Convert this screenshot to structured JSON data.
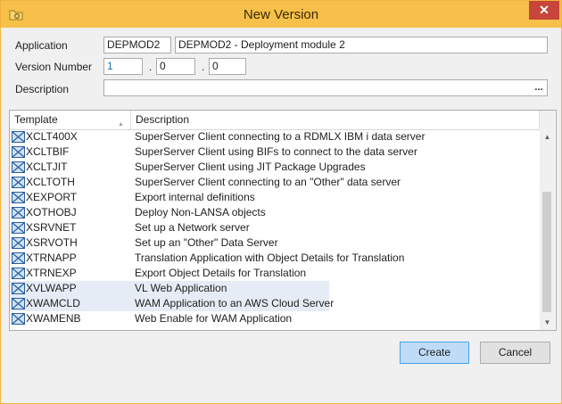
{
  "window": {
    "title": "New Version",
    "close_glyph": "✕"
  },
  "form": {
    "application_label": "Application",
    "application_code": "DEPMOD2",
    "application_description": "DEPMOD2 - Deployment module 2",
    "version_label": "Version Number",
    "version_major": "1",
    "version_minor": "0",
    "version_patch": "0",
    "version_separator": ".",
    "description_label": "Description",
    "description_value": "",
    "browse_glyph": "..."
  },
  "grid": {
    "columns": [
      "Template",
      "Description"
    ],
    "sort_glyph": "▲",
    "rows": [
      {
        "template": "XCLT400X",
        "description": "SuperServer Client connecting to a RDMLX IBM i data server",
        "selected": false
      },
      {
        "template": "XCLTBIF",
        "description": "SuperServer Client using BIFs to connect to the data server",
        "selected": false
      },
      {
        "template": "XCLTJIT",
        "description": "SuperServer Client using JIT Package Upgrades",
        "selected": false
      },
      {
        "template": "XCLTOTH",
        "description": "SuperServer Client connecting to an \"Other\" data server",
        "selected": false
      },
      {
        "template": "XEXPORT",
        "description": "Export internal definitions",
        "selected": false
      },
      {
        "template": "XOTHOBJ",
        "description": "Deploy Non-LANSA objects",
        "selected": false
      },
      {
        "template": "XSRVNET",
        "description": "Set up a Network server",
        "selected": false
      },
      {
        "template": "XSRVOTH",
        "description": "Set up an \"Other\" Data Server",
        "selected": false
      },
      {
        "template": "XTRNAPP",
        "description": "Translation Application with Object Details for Translation",
        "selected": false
      },
      {
        "template": "XTRNEXP",
        "description": "Export Object Details for Translation",
        "selected": false
      },
      {
        "template": "XVLWAPP",
        "description": "VL Web Application",
        "selected": true
      },
      {
        "template": "XWAMCLD",
        "description": "WAM Application to an AWS Cloud Server",
        "selected": true
      },
      {
        "template": "XWAMENB",
        "description": "Web Enable for WAM Application",
        "selected": false
      }
    ],
    "scroll_up_glyph": "▲",
    "scroll_down_glyph": "▼"
  },
  "buttons": {
    "create": "Create",
    "cancel": "Cancel"
  },
  "icons": {
    "app": "folder-gear-icon",
    "row": "template-image-icon"
  },
  "colors": {
    "titlebar": "#f6c04a",
    "selection": "#e6ecf6",
    "primary_button": "#bedcf7",
    "close_button": "#c7453a"
  }
}
